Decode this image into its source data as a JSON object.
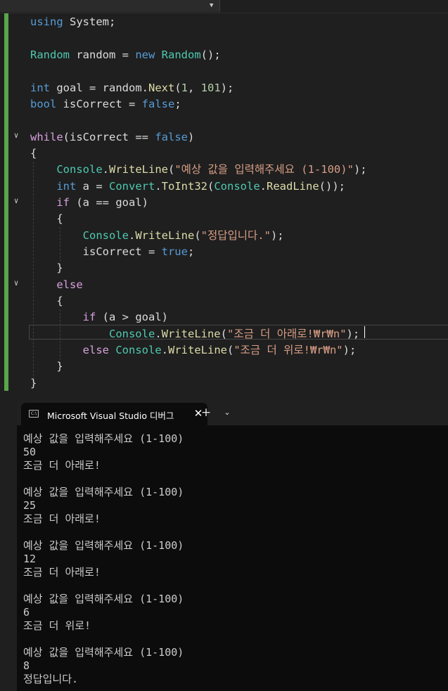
{
  "editor": {
    "lines": [
      [
        {
          "t": "using",
          "c": "kw"
        },
        {
          "t": " System;",
          "c": "pun"
        }
      ],
      [],
      [
        {
          "t": "Random",
          "c": "typ"
        },
        {
          "t": " random = ",
          "c": "pun"
        },
        {
          "t": "new",
          "c": "kw"
        },
        {
          "t": " ",
          "c": "pun"
        },
        {
          "t": "Random",
          "c": "typ"
        },
        {
          "t": "();",
          "c": "pun"
        }
      ],
      [],
      [
        {
          "t": "int",
          "c": "kw"
        },
        {
          "t": " goal = random.",
          "c": "pun"
        },
        {
          "t": "Next",
          "c": "mth"
        },
        {
          "t": "(",
          "c": "pun"
        },
        {
          "t": "1",
          "c": "num"
        },
        {
          "t": ", ",
          "c": "pun"
        },
        {
          "t": "101",
          "c": "num"
        },
        {
          "t": ");",
          "c": "pun"
        }
      ],
      [
        {
          "t": "bool",
          "c": "kw"
        },
        {
          "t": " isCorrect = ",
          "c": "pun"
        },
        {
          "t": "false",
          "c": "kw"
        },
        {
          "t": ";",
          "c": "pun"
        }
      ],
      [],
      [
        {
          "t": "while",
          "c": "ctl"
        },
        {
          "t": "(isCorrect == ",
          "c": "pun"
        },
        {
          "t": "false",
          "c": "kw"
        },
        {
          "t": ")",
          "c": "pun"
        }
      ],
      [
        {
          "t": "{",
          "c": "pun"
        }
      ],
      [
        {
          "t": "    ",
          "c": "pun"
        },
        {
          "t": "Console",
          "c": "typ"
        },
        {
          "t": ".",
          "c": "pun"
        },
        {
          "t": "WriteLine",
          "c": "mth"
        },
        {
          "t": "(",
          "c": "pun"
        },
        {
          "t": "\"예상 값을 입력해주세요 (1-100)\"",
          "c": "str"
        },
        {
          "t": ");",
          "c": "pun"
        }
      ],
      [
        {
          "t": "    ",
          "c": "pun"
        },
        {
          "t": "int",
          "c": "kw"
        },
        {
          "t": " a = ",
          "c": "pun"
        },
        {
          "t": "Convert",
          "c": "typ"
        },
        {
          "t": ".",
          "c": "pun"
        },
        {
          "t": "ToInt32",
          "c": "mth"
        },
        {
          "t": "(",
          "c": "pun"
        },
        {
          "t": "Console",
          "c": "typ"
        },
        {
          "t": ".",
          "c": "pun"
        },
        {
          "t": "ReadLine",
          "c": "mth"
        },
        {
          "t": "());",
          "c": "pun"
        }
      ],
      [
        {
          "t": "    ",
          "c": "pun"
        },
        {
          "t": "if",
          "c": "ctl"
        },
        {
          "t": " (a == goal)",
          "c": "pun"
        }
      ],
      [
        {
          "t": "    {",
          "c": "pun"
        }
      ],
      [
        {
          "t": "        ",
          "c": "pun"
        },
        {
          "t": "Console",
          "c": "typ"
        },
        {
          "t": ".",
          "c": "pun"
        },
        {
          "t": "WriteLine",
          "c": "mth"
        },
        {
          "t": "(",
          "c": "pun"
        },
        {
          "t": "\"정답입니다.\"",
          "c": "str"
        },
        {
          "t": ");",
          "c": "pun"
        }
      ],
      [
        {
          "t": "        isCorrect = ",
          "c": "pun"
        },
        {
          "t": "true",
          "c": "kw"
        },
        {
          "t": ";",
          "c": "pun"
        }
      ],
      [
        {
          "t": "    }",
          "c": "pun"
        }
      ],
      [
        {
          "t": "    ",
          "c": "pun"
        },
        {
          "t": "else",
          "c": "ctl"
        }
      ],
      [
        {
          "t": "    {",
          "c": "pun"
        }
      ],
      [
        {
          "t": "        ",
          "c": "pun"
        },
        {
          "t": "if",
          "c": "ctl"
        },
        {
          "t": " (a > goal)",
          "c": "pun"
        }
      ],
      [
        {
          "t": "            ",
          "c": "pun"
        },
        {
          "t": "Console",
          "c": "typ"
        },
        {
          "t": ".",
          "c": "pun"
        },
        {
          "t": "WriteLine",
          "c": "mth"
        },
        {
          "t": "(",
          "c": "pun"
        },
        {
          "t": "\"조금 더 아래로!₩r₩n\"",
          "c": "str"
        },
        {
          "t": ");",
          "c": "pun"
        }
      ],
      [
        {
          "t": "        ",
          "c": "pun"
        },
        {
          "t": "else",
          "c": "ctl"
        },
        {
          "t": " ",
          "c": "pun"
        },
        {
          "t": "Console",
          "c": "typ"
        },
        {
          "t": ".",
          "c": "pun"
        },
        {
          "t": "WriteLine",
          "c": "mth"
        },
        {
          "t": "(",
          "c": "pun"
        },
        {
          "t": "\"조금 더 위로!₩r₩n\"",
          "c": "str"
        },
        {
          "t": ");",
          "c": "pun"
        }
      ],
      [
        {
          "t": "    }",
          "c": "pun"
        }
      ],
      [
        {
          "t": "}",
          "c": "pun"
        }
      ]
    ]
  },
  "console": {
    "tab_icon_text": "C:\\",
    "tab_title": "Microsoft Visual Studio 디버그",
    "close_glyph": "✕",
    "new_tab_glyph": "+",
    "dropdown_glyph": "⌄",
    "output": [
      "예상 값을 입력해주세요 (1-100)",
      "50",
      "조금 더 아래로!",
      "",
      "예상 값을 입력해주세요 (1-100)",
      "25",
      "조금 더 아래로!",
      "",
      "예상 값을 입력해주세요 (1-100)",
      "12",
      "조금 더 아래로!",
      "",
      "예상 값을 입력해주세요 (1-100)",
      "6",
      "조금 더 위로!",
      "",
      "예상 값을 입력해주세요 (1-100)",
      "8",
      "정답입니다."
    ]
  },
  "colors": {
    "keyword": "#569cd6",
    "control": "#d8a0df",
    "type": "#4ec9b0",
    "string": "#d69d85",
    "method": "#dcdcaa",
    "number": "#b5cea8",
    "change_bar": "#57a64a"
  }
}
